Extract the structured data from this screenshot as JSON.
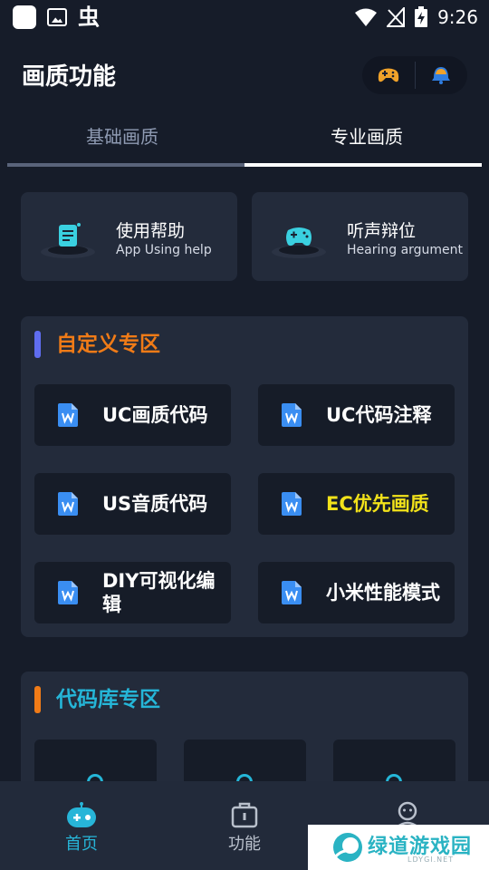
{
  "status_bar": {
    "time": "9:26",
    "bug_glyph": "虫"
  },
  "header": {
    "title": "画质功能",
    "icons": [
      "game-controller-icon",
      "bell-icon"
    ]
  },
  "tabs": [
    {
      "label": "基础画质",
      "active": false
    },
    {
      "label": "专业画质",
      "active": true
    }
  ],
  "help_cards": [
    {
      "title": "使用帮助",
      "subtitle": "App Using help",
      "icon": "help-doc-icon"
    },
    {
      "title": "听声辩位",
      "subtitle": "Hearing argument",
      "icon": "gamepad-icon"
    }
  ],
  "custom_section": {
    "title": "自定义专区",
    "title_color": "#f07b17",
    "bar_color": "#5f6df0",
    "items": [
      {
        "label": "UC画质代码",
        "highlight": false
      },
      {
        "label": "UC代码注释",
        "highlight": false
      },
      {
        "label": "US音质代码",
        "highlight": false
      },
      {
        "label": "EC优先画质",
        "highlight": true
      },
      {
        "label": "DIY可视化编辑",
        "highlight": false
      },
      {
        "label": "小米性能模式",
        "highlight": false
      }
    ]
  },
  "code_section": {
    "title": "代码库专区",
    "title_color": "#25b6d8",
    "bar_color": "#f07b17"
  },
  "bottom_nav": [
    {
      "label": "首页",
      "icon": "home-robot-icon",
      "active": true
    },
    {
      "label": "功能",
      "icon": "toolbox-icon",
      "active": false
    },
    {
      "label": "",
      "icon": "profile-icon",
      "active": false
    }
  ],
  "watermark": {
    "text": "绿道游戏园",
    "sub": "LDYGI.NET"
  },
  "colors": {
    "background": "#161c29",
    "card": "#232b3b",
    "accent": "#25b6d8"
  }
}
